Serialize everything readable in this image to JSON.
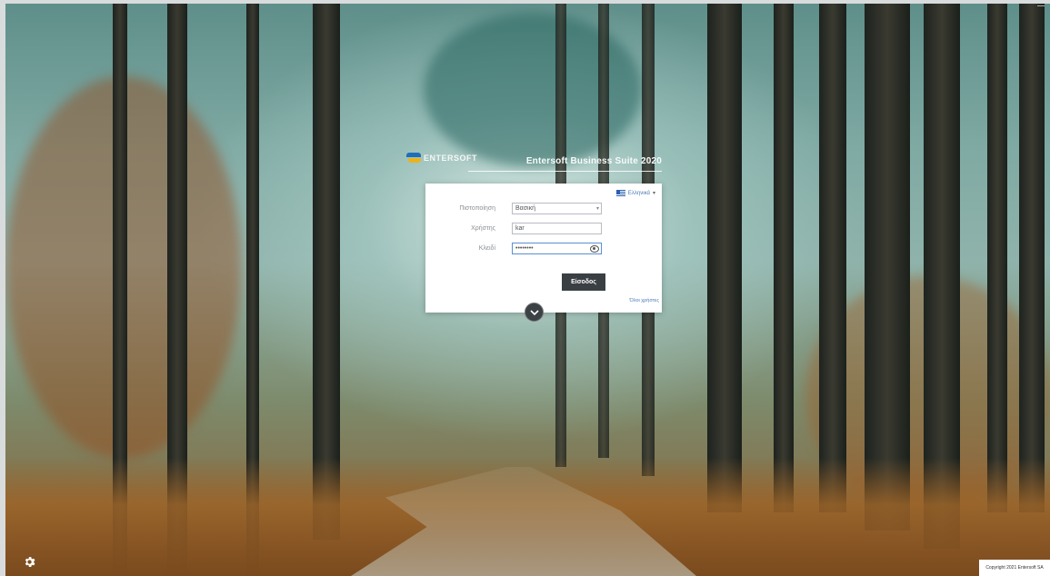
{
  "brand": {
    "logo_text": "ENTERSOFT",
    "product_title": "Entersoft Business Suite 2020"
  },
  "login": {
    "language": "Ελληνικά",
    "database_label": "Πιστοποίηση",
    "database_value": "Βασική",
    "username_label": "Χρήστης",
    "username_value": "kar",
    "password_label": "Κλειδί",
    "password_value": "••••••••",
    "submit_label": "Είσοδος",
    "options_link": "Όλοι χρήστες"
  },
  "footer": {
    "copyright": "Copyright 2021 Entersoft SA"
  },
  "icons": {
    "settings": "gear-icon",
    "expand": "chevron-down-icon",
    "show_password": "eye-icon",
    "language_flag": "greek-flag-icon"
  },
  "colors": {
    "button_bg": "#3a3f44",
    "link": "#4a79b7",
    "brand_blue": "#1f6fb8",
    "brand_yellow": "#e9b320"
  }
}
